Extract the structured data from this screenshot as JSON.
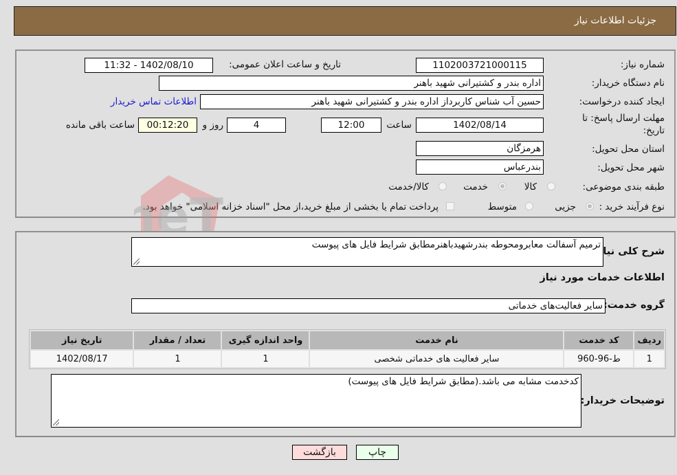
{
  "header": {
    "title": "جزئیات اطلاعات نیاز"
  },
  "form": {
    "need_number": {
      "label": "شماره نیاز:",
      "value": "1102003721000115"
    },
    "announce_datetime": {
      "label": "تاریخ و ساعت اعلان عمومی:",
      "value": "1402/08/10 - 11:32"
    },
    "buyer_org": {
      "label": "نام دستگاه خریدار:",
      "value": "اداره بندر و کشتیرانی شهید باهنر"
    },
    "requester": {
      "label": "ایجاد کننده درخواست:",
      "value": "حسین آب شناس کاربرداز اداره بندر و کشتیرانی شهید باهنر"
    },
    "buyer_contact_link": "اطلاعات تماس خریدار",
    "deadline": {
      "label_line1": "مهلت ارسال پاسخ: تا",
      "label_line2": "تاریخ:",
      "date": "1402/08/14",
      "time_label": "ساعت",
      "time": "12:00",
      "days": "4",
      "days_label": "روز و",
      "remaining": "00:12:20",
      "remaining_label": "ساعت باقی مانده"
    },
    "province": {
      "label": "استان محل تحویل:",
      "value": "هرمزگان"
    },
    "city": {
      "label": "شهر محل تحویل:",
      "value": "بندرعباس"
    },
    "category": {
      "label": "طبقه بندی موضوعی:",
      "options": [
        {
          "label": "کالا",
          "checked": false
        },
        {
          "label": "خدمت",
          "checked": true
        },
        {
          "label": "کالا/خدمت",
          "checked": false
        }
      ]
    },
    "purchase_process": {
      "label": "نوع فرآیند خرید :",
      "options": [
        {
          "label": "جزیی",
          "checked": true
        },
        {
          "label": "متوسط",
          "checked": false
        }
      ],
      "treasury_checkbox_label": "پرداخت تمام یا بخشی از مبلغ خرید،از محل \"اسناد خزانه اسلامی\" خواهد بود.",
      "treasury_checked": false
    }
  },
  "details": {
    "description_label": "شرح کلی نیاز:",
    "description_value": "ترمیم آسفالت معابرومحوطه بندرشهیدباهنرمطابق شرایط فایل های پیوست",
    "services_heading": "اطلاعات خدمات مورد نیاز",
    "service_group_label": "گروه خدمت:",
    "service_group_value": "سایر فعالیت‌های خدماتی",
    "table": {
      "headers": [
        "ردیف",
        "کد خدمت",
        "نام خدمت",
        "واحد اندازه گیری",
        "تعداد / مقدار",
        "تاریخ نیاز"
      ],
      "rows": [
        [
          "1",
          "ط-96-960",
          "سایر فعالیت های خدماتی شخصی",
          "1",
          "1",
          "1402/08/17"
        ]
      ]
    },
    "buyer_notes_label": "توضیحات خریدار:",
    "buyer_notes_value": "کدخدمت مشابه می باشد.(مطابق شرایط فایل های پیوست)"
  },
  "buttons": {
    "print": "چاپ",
    "back": "بازگشت"
  },
  "watermark": {
    "text": "AriaTender.neT"
  },
  "colors": {
    "header_bg": "#8b6b43",
    "print_bg": "#eaffea",
    "back_bg": "#ffdcdc",
    "link": "#1a1ad0"
  }
}
